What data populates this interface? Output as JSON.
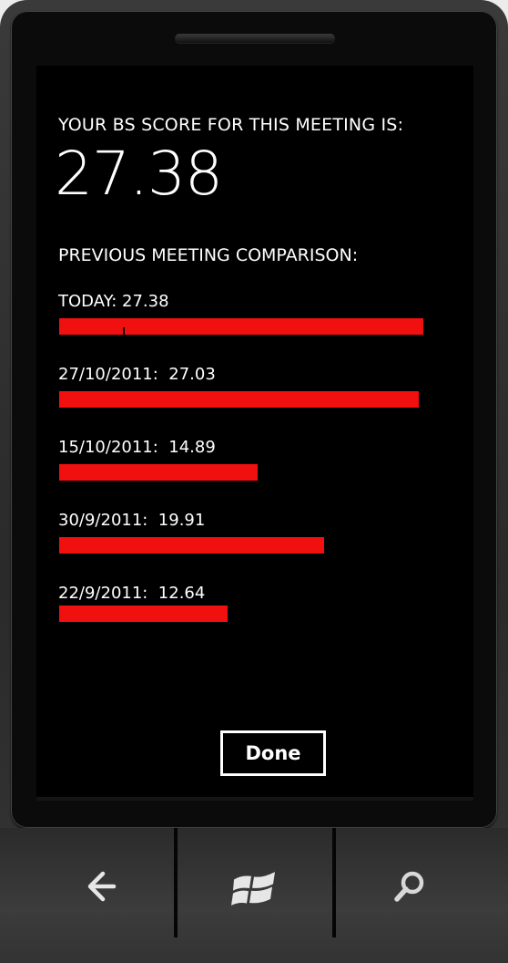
{
  "score_screen": {
    "heading": "YOUR BS SCORE FOR THIS MEETING IS:",
    "score": "27.38",
    "comparison_heading": "PREVIOUS MEETING COMPARISON:"
  },
  "meetings": [
    {
      "label": "TODAY: 27.38",
      "value": 27.38
    },
    {
      "label": "27/10/2011:  27.03",
      "value": 27.03
    },
    {
      "label": "15/10/2011:  14.89",
      "value": 14.89
    },
    {
      "label": "30/9/2011:  19.91",
      "value": 19.91
    },
    {
      "label": "22/9/2011:  12.64",
      "value": 12.64
    }
  ],
  "bar_max_value": 27.38,
  "actions": {
    "done_label": "Done"
  },
  "hardware_keys": [
    {
      "name": "back-key",
      "icon": "back-arrow-icon"
    },
    {
      "name": "start-key",
      "icon": "windows-logo-icon"
    },
    {
      "name": "search-key",
      "icon": "search-icon"
    }
  ],
  "colors": {
    "bar": "#f01010",
    "screen_background": "#000000",
    "text": "#ffffff"
  }
}
